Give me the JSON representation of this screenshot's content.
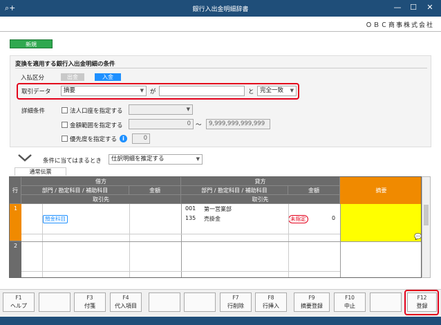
{
  "window": {
    "title": "銀行入出金明細辞書",
    "search_glyph": "⌕+",
    "min": "—",
    "max": "☐",
    "close": "✕"
  },
  "company": "ＯＢＣ商事株式会社",
  "new_label": "新規",
  "conditions": {
    "title": "変換を適用する銀行入出金明細の条件",
    "direction_label": "入払区分",
    "out_label": "出金",
    "in_label": "入金",
    "data_label": "取引データ",
    "data_select": "摘要",
    "ga": "が",
    "to": "と",
    "match_select": "完全一致",
    "match_value": "",
    "detail_label": "詳細条件",
    "corp_account": "法人口座を指定する",
    "amount_range": "金額範囲を指定する",
    "amount_from": "0",
    "amount_tilde": "～",
    "amount_to": "9,999,999,999,999",
    "priority": "優先度を指定する",
    "priority_value": "0"
  },
  "apply": {
    "label": "条件に当てはまるとき",
    "select": "仕訳明細を推定する"
  },
  "tab_normal": "通常伝票",
  "grid": {
    "row_hdr": "行",
    "debit": "借方",
    "credit": "貸方",
    "dept_acct": "部門 / 勘定科目 / 補助科目",
    "amount": "金額",
    "partner": "取引先",
    "memo": "摘要",
    "rows": [
      {
        "no": "1",
        "debit_tag": "預金科目",
        "credit_code1": "001",
        "credit_name1": "第一営業部",
        "credit_code2": "135",
        "credit_name2": "売掛金",
        "credit_tag": "未指定",
        "credit_amount": "0"
      },
      {
        "no": "2"
      }
    ]
  },
  "fkeys": [
    {
      "key": "F1",
      "label": "ヘルプ"
    },
    {
      "key": "",
      "label": ""
    },
    {
      "key": "F3",
      "label": "付箋"
    },
    {
      "key": "F4",
      "label": "代入項目"
    },
    {
      "key": "",
      "label": ""
    },
    {
      "key": "",
      "label": ""
    },
    {
      "key": "F7",
      "label": "行削除"
    },
    {
      "key": "F8",
      "label": "行挿入"
    },
    {
      "key": "F9",
      "label": "摘要登録"
    },
    {
      "key": "F10",
      "label": "中止"
    },
    {
      "key": "",
      "label": ""
    },
    {
      "key": "F12",
      "label": "登録"
    }
  ],
  "colors": {
    "titlebar": "#1f4e79",
    "accent_orange": "#f08a00",
    "memo_yellow": "#ffff00",
    "highlight_red": "#e3001b",
    "green": "#2fa84f"
  }
}
